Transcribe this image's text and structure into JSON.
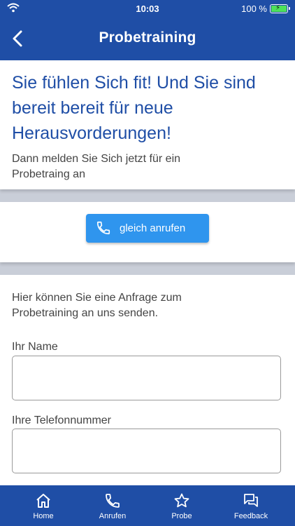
{
  "status_bar": {
    "time": "10:03",
    "battery": "100 %"
  },
  "app_bar": {
    "title": "Probetraining"
  },
  "hero": {
    "title": "Sie fühlen Sich fit! Und Sie sind bereit bereit für neue Herausvorderungen!",
    "subtitle": "Dann melden Sie Sich jetzt für ein Probetraing an"
  },
  "call": {
    "button_label": "gleich anrufen"
  },
  "form": {
    "intro": "Hier können Sie eine Anfrage zum Probetraining an uns senden.",
    "name_label": "Ihr Name",
    "name_value": "",
    "phone_label": "Ihre Telefonnummer",
    "phone_value": ""
  },
  "bottom_nav": {
    "items": [
      {
        "label": "Home",
        "icon": "home-icon"
      },
      {
        "label": "Anrufen",
        "icon": "phone-icon"
      },
      {
        "label": "Probe",
        "icon": "star-icon"
      },
      {
        "label": "Feedback",
        "icon": "feedback-icon"
      }
    ]
  },
  "colors": {
    "primary": "#1f4ea6",
    "accent": "#2f95ee",
    "background": "#c9ced8"
  }
}
